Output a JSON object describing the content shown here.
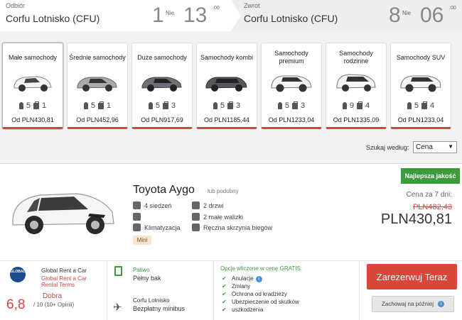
{
  "header": {
    "pickup": {
      "label": "Odbiór",
      "location": "Corfu Lotnisko (CFU)",
      "day": "1",
      "weekday": "Nie",
      "hour": "13",
      "minute": ":00"
    },
    "return": {
      "label": "Zwrot",
      "location": "Corfu Lotnisko (CFU)",
      "day": "8",
      "weekday": "Nie",
      "hour": "06",
      "minute": ":00"
    }
  },
  "categories": [
    {
      "name": "Małe samochody",
      "seats": "5",
      "bags": "1",
      "price": "Od PLN430,81"
    },
    {
      "name": "Średnie samochody",
      "seats": "5",
      "bags": "1",
      "price": "Od PLN452,96"
    },
    {
      "name": "Duże samochody",
      "seats": "5",
      "bags": "3",
      "price": "Od PLN917,69"
    },
    {
      "name": "Samochody kombi",
      "seats": "5",
      "bags": "3",
      "price": "Od PLN1185,44"
    },
    {
      "name": "Samochody premium",
      "seats": "5",
      "bags": "3",
      "price": "Od PLN1233,04"
    },
    {
      "name": "Samochody rodzinne",
      "seats": "9",
      "bags": "4",
      "price": "Od PLN1335,09"
    },
    {
      "name": "Samochody SUV",
      "seats": "5",
      "bags": "4",
      "price": "Od PLN1233,04"
    }
  ],
  "sort": {
    "label": "Szukaj według:",
    "value": "Cena"
  },
  "result": {
    "badge": "Najlepsza jakość",
    "model": "Toyota Aygo",
    "similar": "lub podobny",
    "features": {
      "seats": "4 siedzeń",
      "doors": "2 drzwi",
      "bags": "2 małe walizki",
      "ac": "Klimatyzacja",
      "gearbox": "Ręczna skrzynia biegów"
    },
    "size_tag": "Mini",
    "price_for": "Cena za 7 dni:",
    "price_old": "PLN482,43",
    "price_new": "PLN430,81",
    "supplier": {
      "logo": "GLOBAL",
      "name": "Global Rent a Car",
      "link1": "Global Rent a Car",
      "link2": "Rental Terms",
      "rating": "6,8",
      "rating_word": "Dobra",
      "rating_sub": "/ 10 (10+ Opinii)"
    },
    "fuel": {
      "label": "Paliwo",
      "value": "Pełny bak"
    },
    "airport": {
      "label": "Corfu Lotnisko",
      "value": "Bezpłatny minibus"
    },
    "included": {
      "title": "Opcje wliczone w cenę GRATIS:",
      "items": [
        "Anulacje",
        "Zmiany",
        "Ochrona od kradzieży",
        "Ubezpieczenie od skutków",
        "uszkodzenia"
      ]
    },
    "book_label": "Zarezerwuj Teraz",
    "save_label": "Zachowaj na później"
  },
  "colors": {
    "accent_red": "#d9473a",
    "accent_green": "#3a9c3a"
  }
}
